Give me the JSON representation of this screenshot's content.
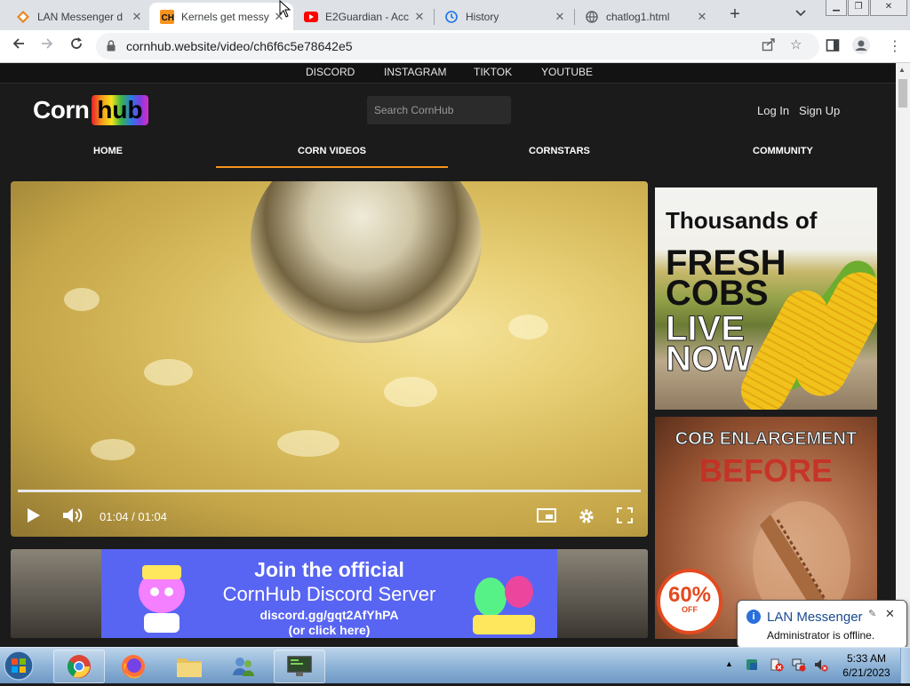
{
  "tabs": [
    {
      "title": "LAN Messenger d",
      "icon": "lan-messenger-favicon"
    },
    {
      "title": "Kernels get messy",
      "icon": "cornhub-favicon"
    },
    {
      "title": "E2Guardian - Acc",
      "icon": "youtube-favicon"
    },
    {
      "title": "History",
      "icon": "history-favicon"
    },
    {
      "title": "chatlog1.html",
      "icon": "globe-favicon"
    }
  ],
  "address_bar": {
    "url": "cornhub.website/video/ch6f6c5e78642e5"
  },
  "site": {
    "social_links": [
      "DISCORD",
      "INSTAGRAM",
      "TIKTOK",
      "YOUTUBE"
    ],
    "logo_left": "Corn",
    "logo_right": "hub",
    "search_placeholder": "Search CornHub",
    "login": "Log In",
    "signup": "Sign Up",
    "nav": [
      "HOME",
      "CORN VIDEOS",
      "CORNSTARS",
      "COMMUNITY"
    ],
    "active_nav": "CORN VIDEOS"
  },
  "video": {
    "time": "01:04 / 01:04",
    "progress": 1.0
  },
  "discord_banner": {
    "line1": "Join the official",
    "line2": "CornHub Discord Server",
    "line3": "discord.gg/gqt2AfYhPA",
    "line4": "(or click here)"
  },
  "ad1": {
    "line1": "Thousands of",
    "line2": "FRESH",
    "line3": "COBS",
    "line4": "LIVE",
    "line5": "NOW"
  },
  "ad2": {
    "line1": "COB ENLARGEMENT",
    "line2": "BEFORE",
    "badge_value": "60%",
    "badge_sub": "OFF"
  },
  "notification": {
    "title": "LAN Messenger",
    "message": "Administrator is offline."
  },
  "taskbar": {
    "time": "5:33 AM",
    "date": "6/21/2023"
  },
  "colors": {
    "accent": "#f7931e",
    "discord": "#5865f2",
    "page_bg": "#1b1b1b"
  }
}
